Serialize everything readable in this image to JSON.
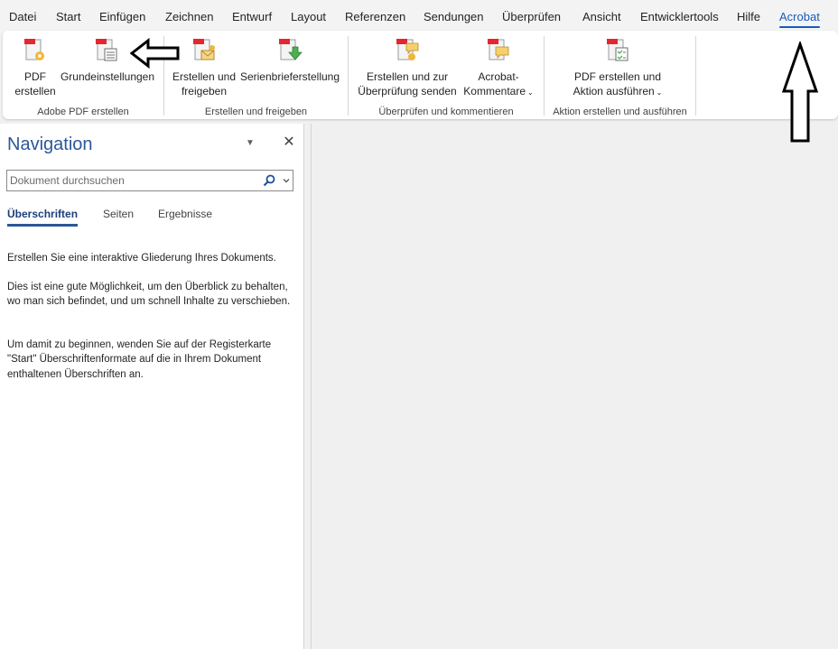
{
  "menu": {
    "items": [
      "Datei",
      "Start",
      "Einfügen",
      "Zeichnen",
      "Entwurf",
      "Layout",
      "Referenzen",
      "Sendungen",
      "Überprüfen",
      "Ansicht",
      "Entwicklertools",
      "Hilfe",
      "Acrobat"
    ],
    "active": "Acrobat"
  },
  "ribbon": {
    "groups": [
      {
        "label": "Adobe PDF erstellen",
        "buttons": [
          {
            "label_line1": "PDF",
            "label_line2": "erstellen",
            "icon": "pdf-create-icon"
          },
          {
            "label_line1": "Grundeinstellungen",
            "label_line2": "",
            "icon": "preferences-icon"
          }
        ]
      },
      {
        "label": "Erstellen und freigeben",
        "buttons": [
          {
            "label_line1": "Erstellen und",
            "label_line2": "freigeben",
            "icon": "create-share-icon"
          },
          {
            "label_line1": "Serienbrieferstellung",
            "label_line2": "",
            "icon": "mail-merge-icon"
          }
        ]
      },
      {
        "label": "Überprüfen und kommentieren",
        "buttons": [
          {
            "label_line1": "Erstellen und zur",
            "label_line2": "Überprüfung senden",
            "icon": "send-review-icon"
          },
          {
            "label_line1": "Acrobat-",
            "label_line2": "Kommentare",
            "icon": "comments-icon",
            "dropdown": true
          }
        ]
      },
      {
        "label": "Aktion erstellen und ausführen",
        "buttons": [
          {
            "label_line1": "PDF erstellen und",
            "label_line2": "Aktion ausführen",
            "icon": "run-action-icon",
            "dropdown": true
          }
        ]
      }
    ]
  },
  "nav": {
    "title": "Navigation",
    "search_placeholder": "Dokument durchsuchen",
    "tabs": [
      "Überschriften",
      "Seiten",
      "Ergebnisse"
    ],
    "active_tab": "Überschriften",
    "paragraphs": [
      "Erstellen Sie eine interaktive Gliederung Ihres Dokuments.",
      "Dies ist eine gute Möglichkeit, um den Überblick zu behalten, wo man sich befindet, und um schnell Inhalte zu verschieben.",
      "Um damit zu beginnen, wenden Sie auf der Registerkarte \"Start\" Überschriftenformate auf die in Ihrem Dokument enthaltenen Überschriften an."
    ]
  },
  "colors": {
    "accent": "#185abd",
    "nav_title": "#2b579a",
    "pdf_red": "#e5262f",
    "background": "#f0f0f0"
  }
}
